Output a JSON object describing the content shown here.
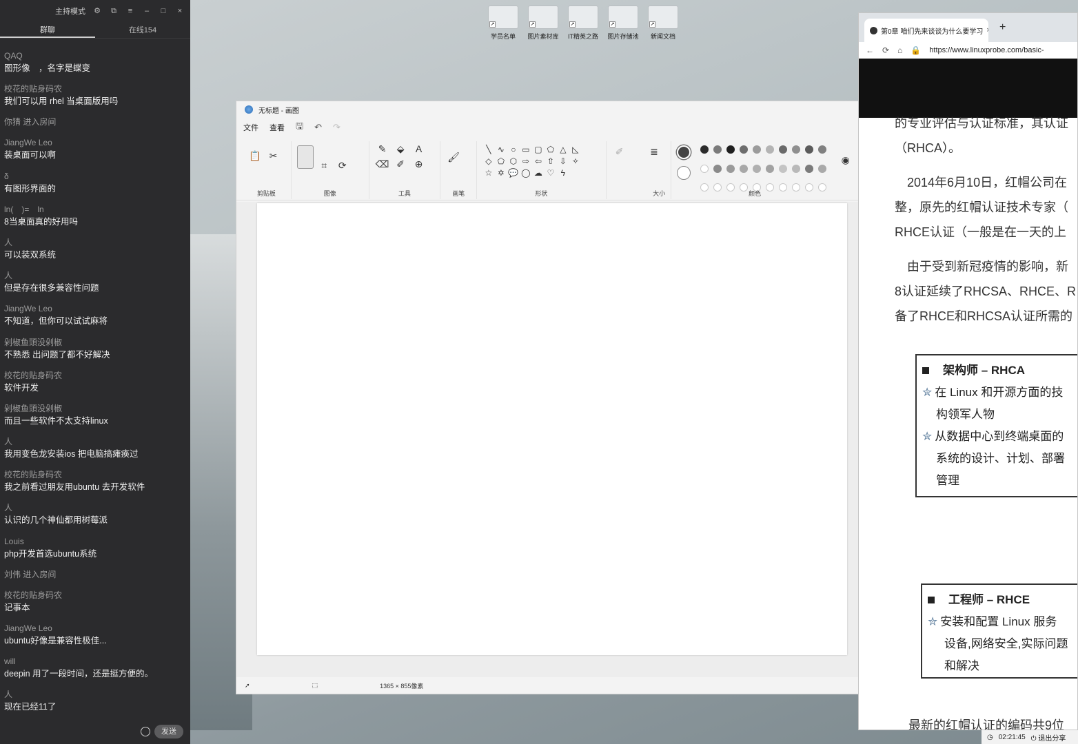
{
  "chat": {
    "title": "主持模式",
    "tabs": [
      "群聊",
      "在线154"
    ],
    "messages": [
      {
        "user": "QAQ",
        "text": "图形像　，名字是蝶变"
      },
      {
        "user": "校花的贴身码农",
        "text": "我们可以用 rhel 当桌面版用吗"
      },
      {
        "user": "",
        "text": "你猜 进入房间",
        "system": true
      },
      {
        "user": "JiangWe Leo",
        "text": "装桌面可以啊"
      },
      {
        "user": "δ",
        "text": "有图形界面的"
      },
      {
        "user": "ln(　)=　ln",
        "text": "8当桌面真的好用吗"
      },
      {
        "user": "人",
        "text": "可以装双系统"
      },
      {
        "user": "人",
        "text": "但是存在很多兼容性问题"
      },
      {
        "user": "JiangWe Leo",
        "text": "不知道，但你可以试试麻将"
      },
      {
        "user": "剁椒鱼頭没剁椒",
        "text": "不熟悉 出问题了都不好解决"
      },
      {
        "user": "校花的贴身码农",
        "text": "软件开发"
      },
      {
        "user": "剁椒鱼頭没剁椒",
        "text": "而且一些软件不太支持linux"
      },
      {
        "user": "人",
        "text": "我用变色龙安装ios 把电脑搞瘫痪过"
      },
      {
        "user": "校花的贴身码农",
        "text": "我之前看过朋友用ubuntu 去开发软件"
      },
      {
        "user": "人",
        "text": "认识的几个神仙都用树莓派"
      },
      {
        "user": "Louis",
        "text": "php开发首选ubuntu系统"
      },
      {
        "user": "",
        "text": "刘伟 进入房间",
        "system": true
      },
      {
        "user": "校花的贴身码农",
        "text": "记事本"
      },
      {
        "user": "JiangWe Leo",
        "text": "ubuntu好像是兼容性极佳..."
      },
      {
        "user": "will",
        "text": "deepin 用了一段时间，还是挺方便的。"
      },
      {
        "user": "人",
        "text": "现在已经11了"
      }
    ],
    "send_label": "发送"
  },
  "desktop": {
    "icons": [
      "学员名单",
      "图片素材库",
      "IT精英之路",
      "图片存储池",
      "新闻文档"
    ]
  },
  "paint": {
    "title": "无标题 - 画图",
    "menu": {
      "file": "文件",
      "view": "查看"
    },
    "groups": {
      "clipboard": "剪贴板",
      "image": "图像",
      "tools": "工具",
      "brushes": "画笔",
      "shapes": "形状",
      "size": "大小",
      "colors": "颜色"
    },
    "status": {
      "size": "1365 × 855像素"
    }
  },
  "browser": {
    "tab_title": "第0章 咱们先来谈谈为什么要学习",
    "url": "https://www.linuxprobe.com/basic-",
    "article": [
      "的专业评估与认证标准，其认证",
      "（RHCA）。",
      "　2014年6月10日，红帽公司在",
      "整，原先的红帽认证技术专家（",
      "RHCE认证（一般是在一天的上",
      "　由于受到新冠疫情的影响，新",
      "8认证延续了RHCSA、RHCE、R",
      "备了RHCE和RHCSA认证所需的"
    ],
    "box1": {
      "heading": "架构师 – RHCA",
      "lines": [
        "在 Linux 和开源方面的技",
        "构领军人物",
        "从数据中心到终端桌面的",
        "系统的设计、计划、部署",
        "管理"
      ]
    },
    "box2": {
      "heading": "工程师 – RHCE",
      "lines": [
        "安装和配置 Linux 服务",
        "设备,网络安全,实际问题",
        "和解决"
      ]
    },
    "bottom_text": "最新的红帽认证的编码共9位"
  },
  "taskbar": {
    "time": "02:21:45",
    "exit": "退出分享"
  }
}
